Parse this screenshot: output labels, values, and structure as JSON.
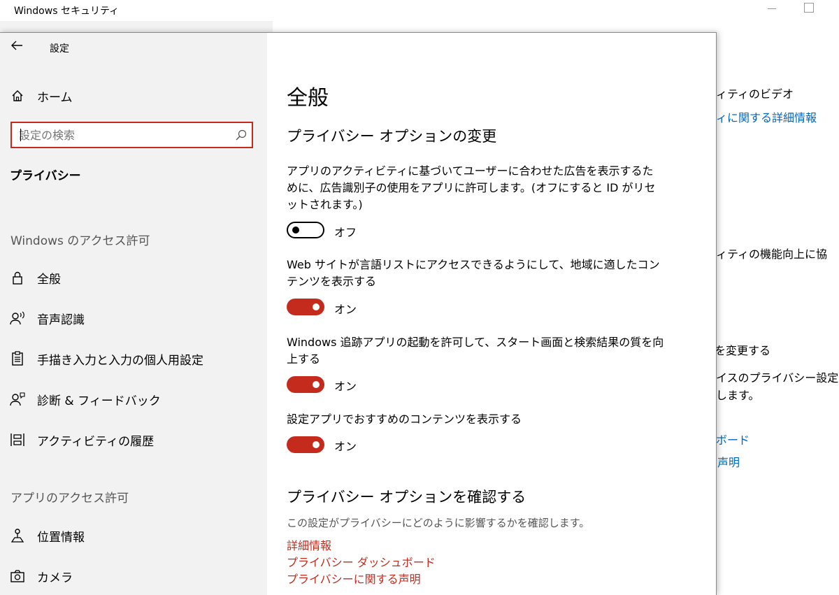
{
  "background_window": {
    "title": "Windows セキュリティ",
    "texts": [
      "ィティのビデオ",
      "ィに関する詳細情報",
      "ィティの機能向上に協",
      "を変更する",
      "イスのプライバシー設定",
      "します。",
      "ボード",
      "声明"
    ]
  },
  "settings": {
    "title": "設定",
    "nav": {
      "home_label": "ホーム",
      "search_placeholder": "設定の検索",
      "current_section": "プライバシー",
      "windows_section": "Windows のアクセス許可",
      "windows_items": [
        {
          "label": "全般",
          "icon": "lock-icon"
        },
        {
          "label": "音声認識",
          "icon": "speech-icon"
        },
        {
          "label": "手描き入力と入力の個人用設定",
          "icon": "clipboard-icon"
        },
        {
          "label": "診断 & フィードバック",
          "icon": "feedback-icon"
        },
        {
          "label": "アクティビティの履歴",
          "icon": "timeline-icon"
        }
      ],
      "app_section": "アプリのアクセス許可",
      "app_items": [
        {
          "label": "位置情報",
          "icon": "location-icon"
        },
        {
          "label": "カメラ",
          "icon": "camera-icon"
        }
      ]
    },
    "content": {
      "page_title": "全般",
      "section1_title": "プライバシー オプションの変更",
      "options": [
        {
          "desc": "アプリのアクティビティに基づいてユーザーに合わせた広告を表示するために、広告識別子の使用をアプリに許可します。(オフにすると ID がリセットされます。)",
          "state": "オフ",
          "on": false
        },
        {
          "desc": "Web サイトが言語リストにアクセスできるようにして、地域に適したコンテンツを表示する",
          "state": "オン",
          "on": true
        },
        {
          "desc": "Windows 追跡アプリの起動を許可して、スタート画面と検索結果の質を向上する",
          "state": "オン",
          "on": true
        },
        {
          "desc": "設定アプリでおすすめのコンテンツを表示する",
          "state": "オン",
          "on": true
        }
      ],
      "section2_title": "プライバシー オプションを確認する",
      "section2_desc": "この設定がプライバシーにどのように影響するかを確認します。",
      "links": [
        "詳細情報",
        "プライバシー ダッシュボード",
        "プライバシーに関する声明"
      ]
    }
  },
  "colors": {
    "accent": "#c42b1c",
    "link_blue": "#0067c0",
    "nav_bg": "#f2f2f2"
  }
}
